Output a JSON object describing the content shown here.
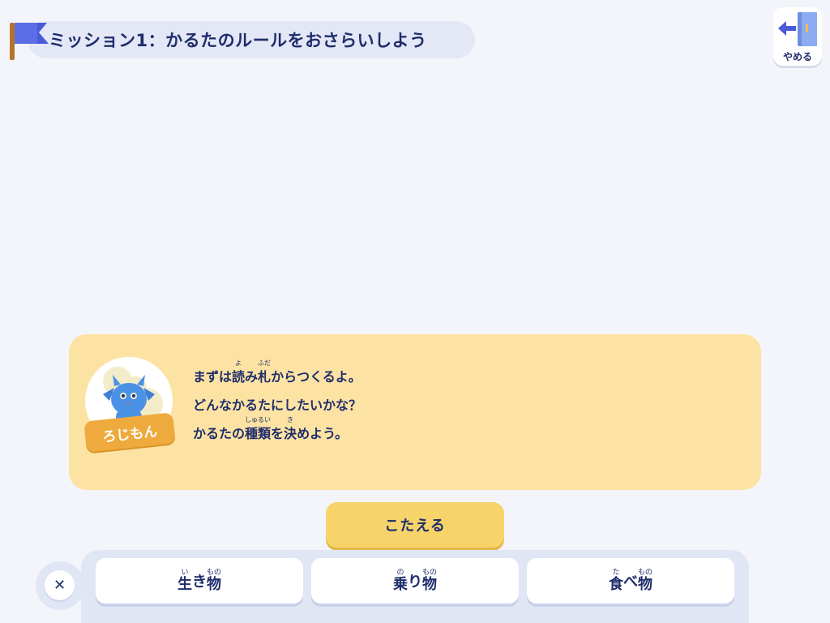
{
  "mission": {
    "title": "ミッション1：かるたのルールをおさらいしよう",
    "flag_icon": "flag-icon",
    "flag_color": "#4a5bd6"
  },
  "quit_button": {
    "label": "やめる",
    "icon": "exit-door-icon"
  },
  "dialog": {
    "speaker": "ろじもん",
    "lines": [
      {
        "pre": "まずは ",
        "ruby": [
          {
            "base": "読",
            "rt": "よ"
          },
          {
            "base": "み",
            "rt": ""
          },
          {
            "base": "札",
            "rt": "ふだ"
          }
        ],
        "post": "からつくるよ。"
      },
      {
        "text": "どんなかるたにしたいかな？"
      },
      {
        "pre": "かるたの",
        "ruby": [
          {
            "base": "種類",
            "rt": "しゅるい"
          },
          {
            "base": "を",
            "rt": ""
          },
          {
            "base": "決",
            "rt": "き"
          }
        ],
        "post": "めよう。"
      }
    ],
    "background": "#fde3a3"
  },
  "answer_button": {
    "label": "こたえる"
  },
  "choices": [
    {
      "ruby": [
        {
          "base": "生",
          "rt": "い"
        },
        {
          "base": "き",
          "rt": ""
        },
        {
          "base": "物",
          "rt": "もの"
        }
      ]
    },
    {
      "ruby": [
        {
          "base": "乗",
          "rt": "の"
        },
        {
          "base": "り",
          "rt": ""
        },
        {
          "base": "物",
          "rt": "もの"
        }
      ]
    },
    {
      "ruby": [
        {
          "base": "食",
          "rt": "た"
        },
        {
          "base": "べ",
          "rt": ""
        },
        {
          "base": "物",
          "rt": "もの"
        }
      ]
    }
  ],
  "close_button": {
    "label": "✕",
    "icon": "close-icon"
  }
}
